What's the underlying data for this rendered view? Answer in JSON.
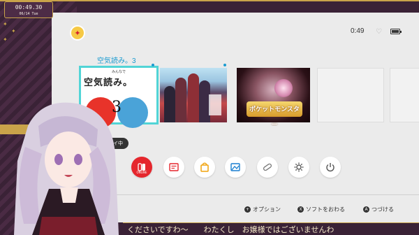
{
  "overlay": {
    "timer": {
      "time": "00:49.30",
      "date": "06/14 Tue"
    },
    "subtitle": "くださいですわ〜　　わたくし　お嬢様ではございませんわ"
  },
  "status": {
    "clock": "0:49"
  },
  "home": {
    "selected_game_title": "空気読み。3",
    "tiles": [
      {
        "small_text": "みんなで",
        "title": "空気読み。",
        "number": "3",
        "badge": "プレイ中"
      },
      {
        "art": "anime-cast-key-art"
      },
      {
        "logo": "ポケットモンスター"
      },
      {
        "empty": true
      },
      {
        "empty": true
      }
    ],
    "bottom_icons": [
      {
        "name": "online",
        "label": "ONLINE"
      },
      {
        "name": "news"
      },
      {
        "name": "eshop"
      },
      {
        "name": "album"
      },
      {
        "name": "controllers"
      },
      {
        "name": "settings"
      },
      {
        "name": "power"
      }
    ],
    "hints": [
      {
        "button": "+",
        "label": "オプション"
      },
      {
        "button": "X",
        "label": "ソフトをおわる"
      },
      {
        "button": "A",
        "label": "つづける"
      }
    ]
  },
  "colors": {
    "accent": "#51d4d6",
    "title_blue": "#1a9bd0",
    "online_red": "#e5262d",
    "frame": "#3a2236",
    "gold": "#c9a34a"
  }
}
